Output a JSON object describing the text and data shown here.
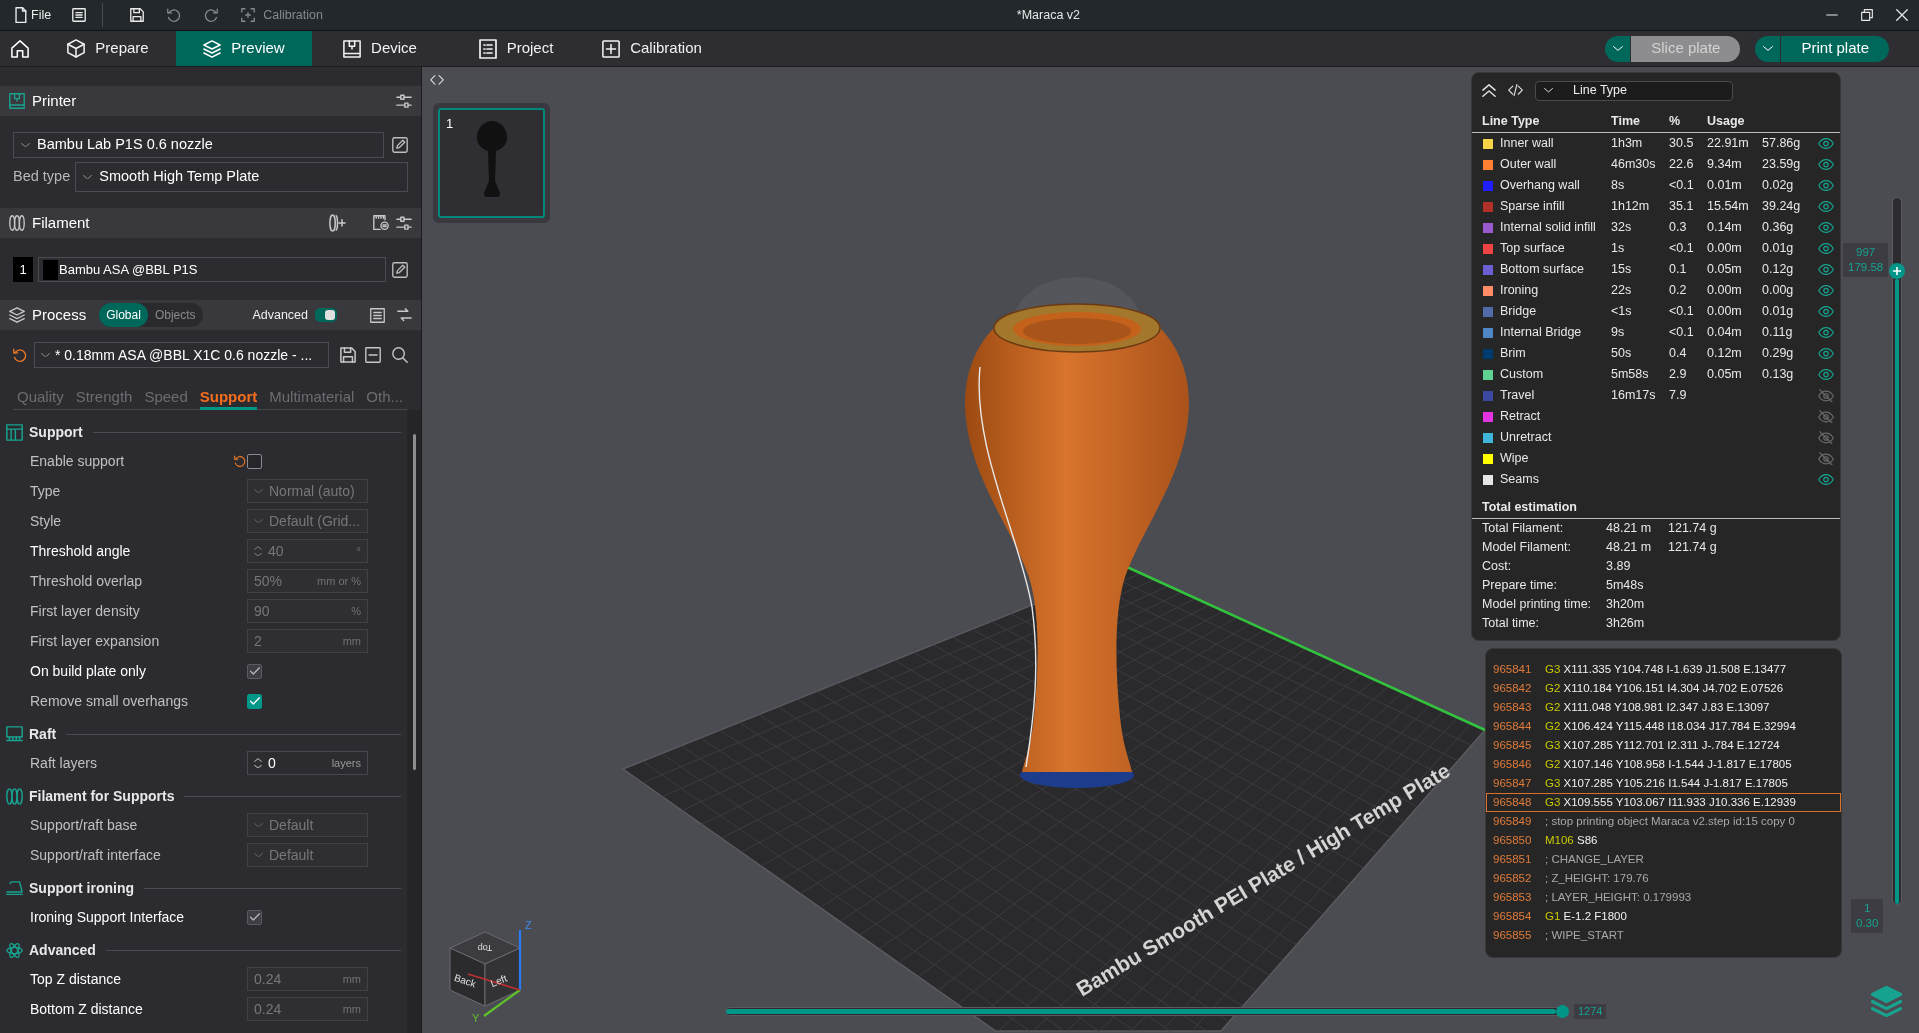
{
  "title_bar": {
    "file_label": "File",
    "toolbar": [
      {
        "kind": "save",
        "disabled": false
      },
      {
        "kind": "undo",
        "disabled": true
      },
      {
        "kind": "redo",
        "disabled": true
      },
      {
        "kind": "calibration",
        "label": "Calibration",
        "disabled": true
      }
    ],
    "title": "*Maraca v2"
  },
  "nav_tabs": [
    {
      "kind": "prepare",
      "label": "Prepare",
      "selected": false
    },
    {
      "kind": "preview",
      "label": "Preview",
      "selected": true
    },
    {
      "kind": "device",
      "label": "Device",
      "selected": false
    },
    {
      "kind": "project",
      "label": "Project",
      "selected": false
    },
    {
      "kind": "calibration",
      "label": "Calibration",
      "selected": false
    }
  ],
  "plate_actions": [
    {
      "label": "Slice plate",
      "disabled": true
    },
    {
      "label": "Print plate",
      "disabled": false
    }
  ],
  "sidebar": {
    "printer": {
      "title": "Printer",
      "preset": "Bambu Lab P1S 0.6 nozzle",
      "bed_type_label": "Bed type",
      "bed_type": "Smooth High Temp Plate"
    },
    "filament": {
      "title": "Filament",
      "items": [
        {
          "number": "1",
          "color": "#000000",
          "name": "Bambu ASA @BBL P1S"
        }
      ]
    },
    "process": {
      "title": "Process",
      "scopes": [
        {
          "label": "Global",
          "selected": true
        },
        {
          "label": "Objects",
          "selected": false
        }
      ],
      "advanced_label": "Advanced",
      "advanced_on": true,
      "preset": "* 0.18mm ASA @BBL X1C 0.6 nozzle - ...",
      "modified": true,
      "tabs": [
        {
          "label": "Quality",
          "selected": false
        },
        {
          "label": "Strength",
          "selected": false
        },
        {
          "label": "Speed",
          "selected": false
        },
        {
          "label": "Support",
          "selected": true
        },
        {
          "label": "Multimaterial",
          "selected": false
        },
        {
          "label": "Oth...",
          "selected": false
        }
      ]
    },
    "settings": [
      {
        "title": "Support",
        "kind": "support",
        "rows": [
          {
            "label": "Enable support",
            "kind": "checkbox",
            "checked": false,
            "disabled": false,
            "highlighted": false,
            "modified": true
          },
          {
            "label": "Type",
            "kind": "dropdown",
            "value": "Normal (auto)",
            "disabled": true,
            "highlighted": false,
            "modified": false
          },
          {
            "label": "Style",
            "kind": "dropdown",
            "value": "Default (Grid...",
            "disabled": true,
            "highlighted": false,
            "modified": false
          },
          {
            "label": "Threshold angle",
            "kind": "spin",
            "value": "40",
            "unit": "°",
            "disabled": true,
            "highlighted": true,
            "modified": false
          },
          {
            "label": "Threshold overlap",
            "kind": "number",
            "value": "50%",
            "unit": "mm or %",
            "disabled": true,
            "highlighted": false,
            "modified": false
          },
          {
            "label": "First layer density",
            "kind": "number",
            "value": "90",
            "unit": "%",
            "disabled": true,
            "highlighted": false,
            "modified": false
          },
          {
            "label": "First layer expansion",
            "kind": "number",
            "value": "2",
            "unit": "mm",
            "disabled": true,
            "highlighted": false,
            "modified": false
          },
          {
            "label": "On build plate only",
            "kind": "checkbox",
            "checked": true,
            "disabled": true,
            "highlighted": true,
            "modified": false
          },
          {
            "label": "Remove small overhangs",
            "kind": "checkbox",
            "checked": true,
            "disabled": false,
            "highlighted": false,
            "modified": false
          }
        ]
      },
      {
        "title": "Raft",
        "kind": "raft",
        "rows": [
          {
            "label": "Raft layers",
            "kind": "spin",
            "value": "0",
            "unit": "layers",
            "disabled": false,
            "highlighted": false,
            "modified": false
          }
        ]
      },
      {
        "title": "Filament for Supports",
        "kind": "filament",
        "rows": [
          {
            "label": "Support/raft base",
            "kind": "dropdown",
            "value": "Default",
            "disabled": true,
            "highlighted": false,
            "modified": false
          },
          {
            "label": "Support/raft interface",
            "kind": "dropdown",
            "value": "Default",
            "disabled": true,
            "highlighted": false,
            "modified": false
          }
        ]
      },
      {
        "title": "Support ironing",
        "kind": "ironing",
        "rows": [
          {
            "label": "Ironing Support Interface",
            "kind": "checkbox",
            "checked": true,
            "disabled": true,
            "highlighted": true,
            "modified": false
          }
        ]
      },
      {
        "title": "Advanced",
        "kind": "advanced",
        "rows": [
          {
            "label": "Top Z distance",
            "kind": "number",
            "value": "0.24",
            "unit": "mm",
            "disabled": true,
            "highlighted": true,
            "modified": false
          },
          {
            "label": "Bottom Z distance",
            "kind": "number",
            "value": "0.24",
            "unit": "mm",
            "disabled": true,
            "highlighted": true,
            "modified": false
          }
        ]
      }
    ]
  },
  "viewport": {
    "plate_thumbnail": {
      "label": "1",
      "selected": true
    },
    "plate_label": "Bambu Smooth PEI Plate / High Temp Plate",
    "view_cube": {
      "faces": [
        "Top",
        "Back",
        "Left"
      ],
      "axes": [
        "Z",
        "Y"
      ]
    },
    "layer_slider": {
      "level": 0.885,
      "upper_readings": [
        "997",
        "179.58"
      ],
      "lower_readings": [
        "1",
        "0.30"
      ]
    },
    "move_slider": {
      "level": 1,
      "reading": "1274"
    }
  },
  "legend": {
    "view_label": "Line Type",
    "columns": [
      "Line Type",
      "Time",
      "%",
      "Usage"
    ],
    "items": [
      {
        "name": "Inner wall",
        "color": "#f5d547",
        "time": "1h3m",
        "percent": "30.5",
        "length": "22.91m",
        "weight": "57.86g",
        "visible": true
      },
      {
        "name": "Outer wall",
        "color": "#ff7f33",
        "time": "46m30s",
        "percent": "22.6",
        "length": "9.34m",
        "weight": "23.59g",
        "visible": true
      },
      {
        "name": "Overhang wall",
        "color": "#1f1fff",
        "time": "8s",
        "percent": "<0.1",
        "length": "0.01m",
        "weight": "0.02g",
        "visible": true
      },
      {
        "name": "Sparse infill",
        "color": "#b0302a",
        "time": "1h12m",
        "percent": "35.1",
        "length": "15.54m",
        "weight": "39.24g",
        "visible": true
      },
      {
        "name": "Internal solid infill",
        "color": "#9b59d0",
        "time": "32s",
        "percent": "0.3",
        "length": "0.14m",
        "weight": "0.36g",
        "visible": true
      },
      {
        "name": "Top surface",
        "color": "#f04343",
        "time": "1s",
        "percent": "<0.1",
        "length": "0.00m",
        "weight": "0.01g",
        "visible": true
      },
      {
        "name": "Bottom surface",
        "color": "#6b5fd1",
        "time": "15s",
        "percent": "0.1",
        "length": "0.05m",
        "weight": "0.12g",
        "visible": true
      },
      {
        "name": "Ironing",
        "color": "#ff8c66",
        "time": "22s",
        "percent": "0.2",
        "length": "0.00m",
        "weight": "0.00g",
        "visible": true
      },
      {
        "name": "Bridge",
        "color": "#4e6aa8",
        "time": "<1s",
        "percent": "<0.1",
        "length": "0.00m",
        "weight": "0.01g",
        "visible": true
      },
      {
        "name": "Internal Bridge",
        "color": "#4f86c6",
        "time": "9s",
        "percent": "<0.1",
        "length": "0.04m",
        "weight": "0.11g",
        "visible": true
      },
      {
        "name": "Brim",
        "color": "#003b6f",
        "time": "50s",
        "percent": "0.4",
        "length": "0.12m",
        "weight": "0.29g",
        "visible": true
      },
      {
        "name": "Custom",
        "color": "#5ed193",
        "time": "5m58s",
        "percent": "2.9",
        "length": "0.05m",
        "weight": "0.13g",
        "visible": true
      },
      {
        "name": "Travel",
        "color": "#3b4aa0",
        "time": "16m17s",
        "percent": "7.9",
        "visible": false
      },
      {
        "name": "Retract",
        "color": "#e133e1",
        "visible": false
      },
      {
        "name": "Unretract",
        "color": "#3fb5d9",
        "visible": false
      },
      {
        "name": "Wipe",
        "color": "#ffff00",
        "visible": false
      },
      {
        "name": "Seams",
        "color": "#e6e6e6",
        "visible": true
      }
    ],
    "totals_title": "Total estimation",
    "totals": [
      {
        "label": "Total Filament:",
        "values": [
          "48.21 m",
          "121.74 g"
        ]
      },
      {
        "label": "Model Filament:",
        "values": [
          "48.21 m",
          "121.74 g"
        ]
      },
      {
        "label": "Cost:",
        "values": [
          "3.89"
        ]
      },
      {
        "label": "Prepare time:",
        "values": [
          "5m48s"
        ]
      },
      {
        "label": "Model printing time:",
        "values": [
          "3h20m"
        ]
      },
      {
        "label": "Total time:",
        "values": [
          "3h26m"
        ]
      }
    ]
  },
  "gcode_viewer": {
    "lines": [
      {
        "number": "965841",
        "kind": "command",
        "command": "G3",
        "params": "X111.335 Y104.748 I-1.639 J1.508 E.13477",
        "selected": false
      },
      {
        "number": "965842",
        "kind": "command",
        "command": "G2",
        "params": "X110.184 Y106.151 I4.304 J4.702 E.07526",
        "selected": false
      },
      {
        "number": "965843",
        "kind": "command",
        "command": "G2",
        "params": "X111.048 Y108.981 I2.347 J.83 E.13097",
        "selected": false
      },
      {
        "number": "965844",
        "kind": "command",
        "command": "G2",
        "params": "X106.424 Y115.448 I18.034 J17.784 E.32994",
        "selected": false
      },
      {
        "number": "965845",
        "kind": "command",
        "command": "G3",
        "params": "X107.285 Y112.701 I2.311 J-.784 E.12724",
        "selected": false
      },
      {
        "number": "965846",
        "kind": "command",
        "command": "G2",
        "params": "X107.146 Y108.958 I-1.544 J-1.817 E.17805",
        "selected": false
      },
      {
        "number": "965847",
        "kind": "command",
        "command": "G3",
        "params": "X107.285 Y105.216 I1.544 J-1.817 E.17805",
        "selected": false
      },
      {
        "number": "965848",
        "kind": "command",
        "command": "G3",
        "params": "X109.555 Y103.067 I11.933 J10.336 E.12939",
        "selected": true
      },
      {
        "number": "965849",
        "kind": "comment",
        "text": "; stop printing object Maraca v2.step id:15 copy 0",
        "selected": false
      },
      {
        "number": "965850",
        "kind": "command",
        "command": "M106",
        "params": "S86",
        "selected": false
      },
      {
        "number": "965851",
        "kind": "comment",
        "text": "; CHANGE_LAYER",
        "selected": false
      },
      {
        "number": "965852",
        "kind": "comment",
        "text": "; Z_HEIGHT: 179.76",
        "selected": false
      },
      {
        "number": "965853",
        "kind": "comment",
        "text": "; LAYER_HEIGHT: 0.179993",
        "selected": false
      },
      {
        "number": "965854",
        "kind": "command",
        "command": "G1",
        "params": "E-1.2 F1800",
        "selected": false
      },
      {
        "number": "965855",
        "kind": "comment",
        "text": "; WIPE_START",
        "selected": false
      }
    ]
  }
}
